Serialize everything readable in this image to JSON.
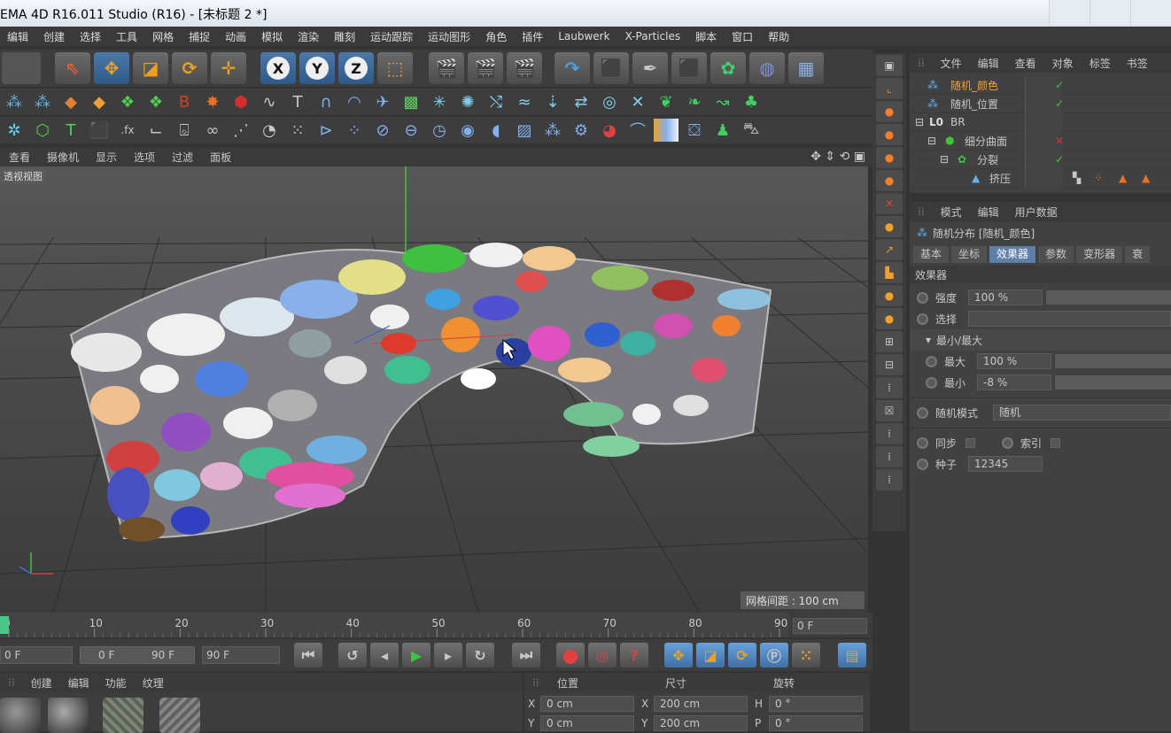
{
  "titlebar": {
    "title": "EMA 4D R16.011 Studio (R16) - [未标题 2 *]"
  },
  "menubar": [
    "编辑",
    "创建",
    "选择",
    "工具",
    "网格",
    "捕捉",
    "动画",
    "模拟",
    "渲染",
    "雕刻",
    "运动跟踪",
    "运动图形",
    "角色",
    "插件",
    "Laubwerk",
    "X-Particles",
    "脚本",
    "窗口",
    "帮助"
  ],
  "toolbar": {
    "axis_x": "X",
    "axis_y": "Y",
    "axis_z": "Z"
  },
  "viewport_menu": [
    "查看",
    "摄像机",
    "显示",
    "选项",
    "过滤",
    "面板"
  ],
  "viewport": {
    "label": "透视视图",
    "grid_spacing": "网格间距 : 100 cm"
  },
  "object_panel": {
    "menu": [
      "文件",
      "编辑",
      "查看",
      "对象",
      "标签",
      "书签"
    ],
    "objects": [
      {
        "name": "随机_颜色",
        "highlight": true,
        "status": "check"
      },
      {
        "name": "随机_位置",
        "highlight": false,
        "status": "check"
      },
      {
        "name": "BR",
        "highlight": false,
        "status": ""
      },
      {
        "name": "细分曲面",
        "highlight": false,
        "status": "x"
      },
      {
        "name": "分裂",
        "highlight": false,
        "status": "check"
      },
      {
        "name": "挤压",
        "highlight": false,
        "status": ""
      }
    ]
  },
  "attr_panel": {
    "menu": [
      "模式",
      "编辑",
      "用户数据"
    ],
    "header": "随机分布 [随机_颜色]",
    "tabs": [
      "基本",
      "坐标",
      "效果器",
      "参数",
      "变形器",
      "衰"
    ],
    "active_tab": 2,
    "section": "效果器",
    "strength_label": "强度",
    "strength_value": "100 %",
    "select_label": "选择",
    "minmax_label": "最小/最大",
    "max_label": "最大",
    "max_value": "100 %",
    "min_label": "最小",
    "min_value": "-8 %",
    "random_mode_label": "随机模式",
    "random_mode_value": "随机",
    "sync_label": "同步",
    "index_label": "索引",
    "seed_label": "种子",
    "seed_value": "12345"
  },
  "timeline": {
    "ticks": [
      "0",
      "10",
      "20",
      "30",
      "40",
      "50",
      "60",
      "70",
      "80",
      "90"
    ],
    "current_frame": "0 F",
    "playhead_fraction": 0
  },
  "transport": {
    "start_field": "0 F",
    "range_start": "0 F",
    "range_end": "90 F",
    "end_field": "90 F"
  },
  "material_panel": {
    "menu": [
      "创建",
      "编辑",
      "功能",
      "纹理"
    ]
  },
  "coord_panel": {
    "headers": [
      "位置",
      "尺寸",
      "旋转"
    ],
    "rows": [
      {
        "a_label": "X",
        "a_value": "0 cm",
        "b_label": "X",
        "b_value": "200 cm",
        "c_label": "H",
        "c_value": "0 °"
      },
      {
        "a_label": "Y",
        "a_value": "0 cm",
        "b_label": "Y",
        "b_value": "200 cm",
        "c_label": "P",
        "c_value": "0 °"
      }
    ]
  },
  "colors": {
    "accent": "#5d7fa8",
    "highlight_text": "#f0a030",
    "check": "#3cc43c",
    "cross": "#e03030"
  }
}
